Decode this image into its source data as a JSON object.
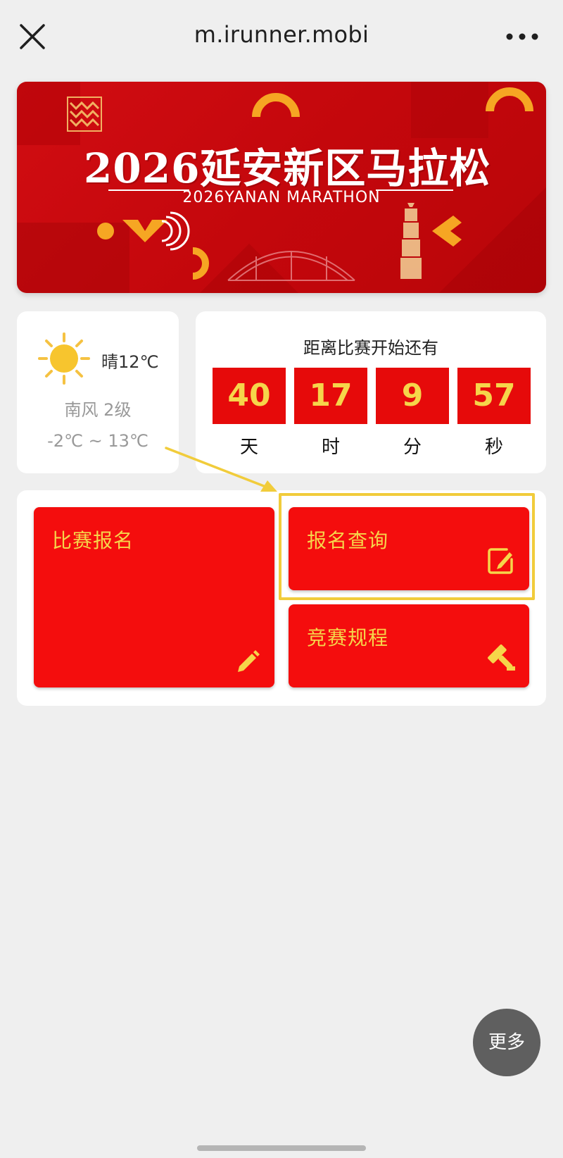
{
  "browser": {
    "url": "m.irunner.mobi"
  },
  "banner": {
    "title": "2026延安新区马拉松",
    "subtitle": "2026YANAN MARATHON"
  },
  "weather": {
    "condition": "晴12℃",
    "wind": "南风  2级",
    "range": "-2℃  ~  13℃",
    "icon": "sun-icon"
  },
  "countdown": {
    "title": "距离比赛开始还有",
    "items": [
      {
        "value": "40",
        "unit": "天"
      },
      {
        "value": "17",
        "unit": "时"
      },
      {
        "value": "9",
        "unit": "分"
      },
      {
        "value": "57",
        "unit": "秒"
      }
    ]
  },
  "menu": {
    "register": {
      "label": "比赛报名",
      "icon": "pencil-icon"
    },
    "query": {
      "label": "报名查询",
      "icon": "edit-icon"
    },
    "rules": {
      "label": "竞赛规程",
      "icon": "gavel-icon"
    }
  },
  "floating": {
    "more_label": "更多"
  },
  "colors": {
    "accent_red": "#f40d0d",
    "accent_gold": "#f6d54a",
    "highlight": "#f1cc3b"
  }
}
